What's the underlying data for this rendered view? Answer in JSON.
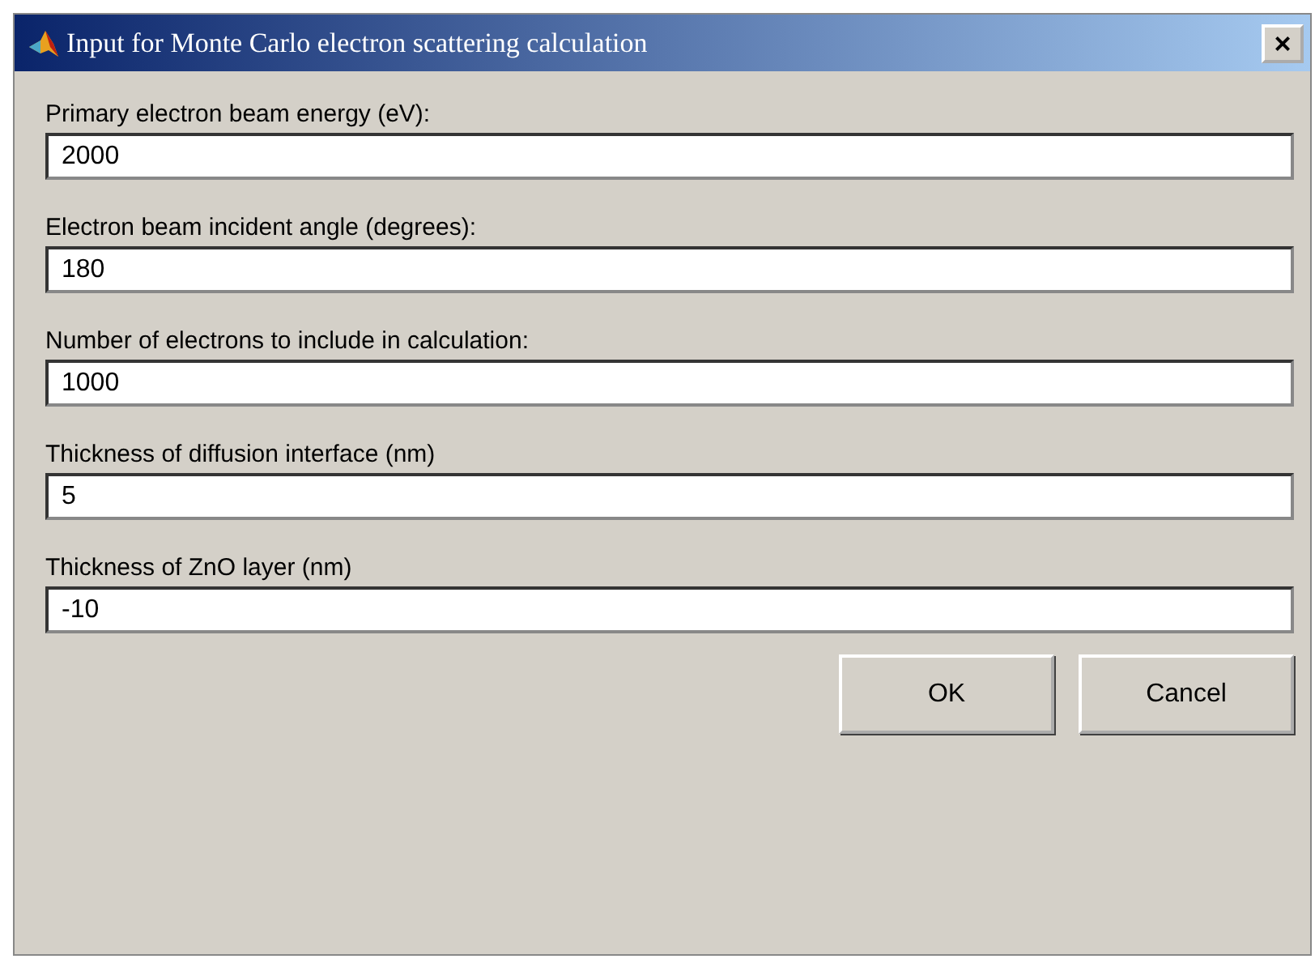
{
  "window": {
    "title": "Input for Monte Carlo electron scattering calculation",
    "close": "×"
  },
  "fields": [
    {
      "label": "Primary electron beam energy (eV):",
      "value": "2000"
    },
    {
      "label": "Electron beam incident angle (degrees):",
      "value": "180"
    },
    {
      "label": "Number of electrons to include in calculation:",
      "value": "1000"
    },
    {
      "label": "Thickness of diffusion interface (nm)",
      "value": "5"
    },
    {
      "label": "Thickness of ZnO layer (nm)",
      "value": "-10"
    }
  ],
  "buttons": [
    "OK",
    "Cancel"
  ]
}
